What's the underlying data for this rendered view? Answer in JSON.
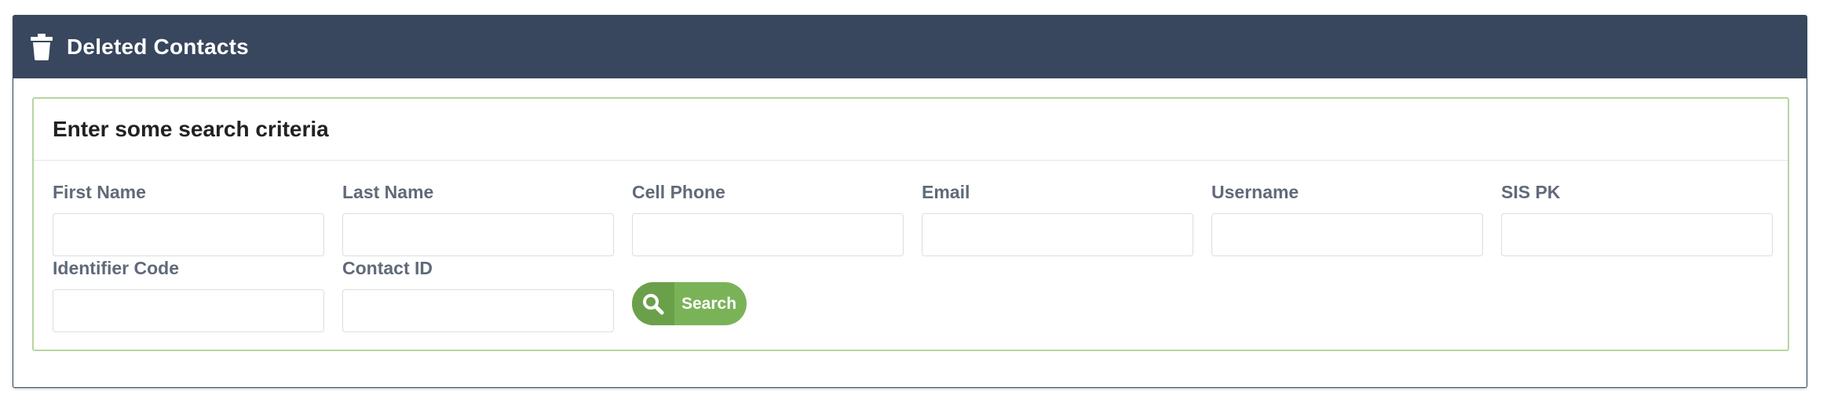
{
  "panel": {
    "title": "Deleted Contacts",
    "icon": "trash-icon",
    "header_color": "#38475e"
  },
  "search": {
    "heading": "Enter some search criteria",
    "border_color": "#b5d6a1",
    "fields": [
      {
        "label": "First Name",
        "value": ""
      },
      {
        "label": "Last Name",
        "value": ""
      },
      {
        "label": "Cell Phone",
        "value": ""
      },
      {
        "label": "Email",
        "value": ""
      },
      {
        "label": "Username",
        "value": ""
      },
      {
        "label": "SIS PK",
        "value": ""
      },
      {
        "label": "Identifier Code",
        "value": ""
      },
      {
        "label": "Contact ID",
        "value": ""
      }
    ],
    "button": {
      "label": "Search",
      "icon": "search-icon",
      "color": "#7ab357"
    }
  }
}
